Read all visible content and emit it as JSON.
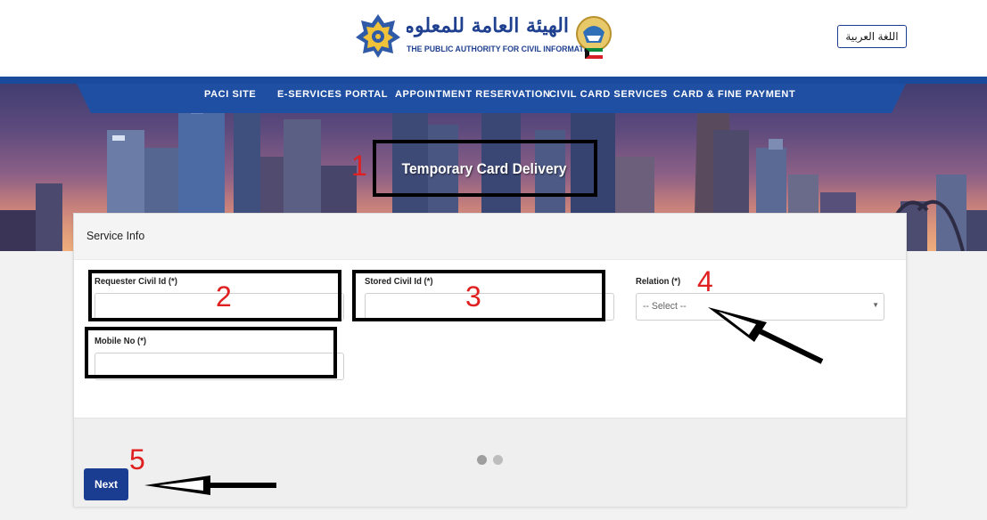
{
  "header": {
    "logo_arabic": "الهيئة العامة للمعلومات المدنية",
    "logo_english": "THE PUBLIC AUTHORITY FOR CIVIL INFORMATION",
    "language_button": "اللغة العربية"
  },
  "nav": {
    "items": [
      {
        "label": "PACI SITE"
      },
      {
        "label": "E-SERVICES PORTAL"
      },
      {
        "label": "APPOINTMENT RESERVATION"
      },
      {
        "label": "CIVIL CARD SERVICES"
      },
      {
        "label": "CARD & FINE PAYMENT"
      }
    ]
  },
  "hero": {
    "title": "Temporary Card Delivery"
  },
  "form": {
    "section_title": "Service Info",
    "requester_civil_id": {
      "label": "Requester Civil Id (*)",
      "value": ""
    },
    "stored_civil_id": {
      "label": "Stored Civil Id (*)",
      "value": ""
    },
    "relation": {
      "label": "Relation (*)",
      "selected": "-- Select --"
    },
    "mobile_no": {
      "label": "Mobile No (*)",
      "value": ""
    },
    "next_button": "Next",
    "step_indicator": {
      "total": 2,
      "current": 1
    }
  },
  "annotations": {
    "numbers": [
      "1",
      "2",
      "3",
      "4",
      "5"
    ],
    "number_color": "#e02020",
    "box_color": "#000000"
  },
  "colors": {
    "brand_blue": "#1a3d91",
    "nav_blue": "#1f4fa3"
  }
}
